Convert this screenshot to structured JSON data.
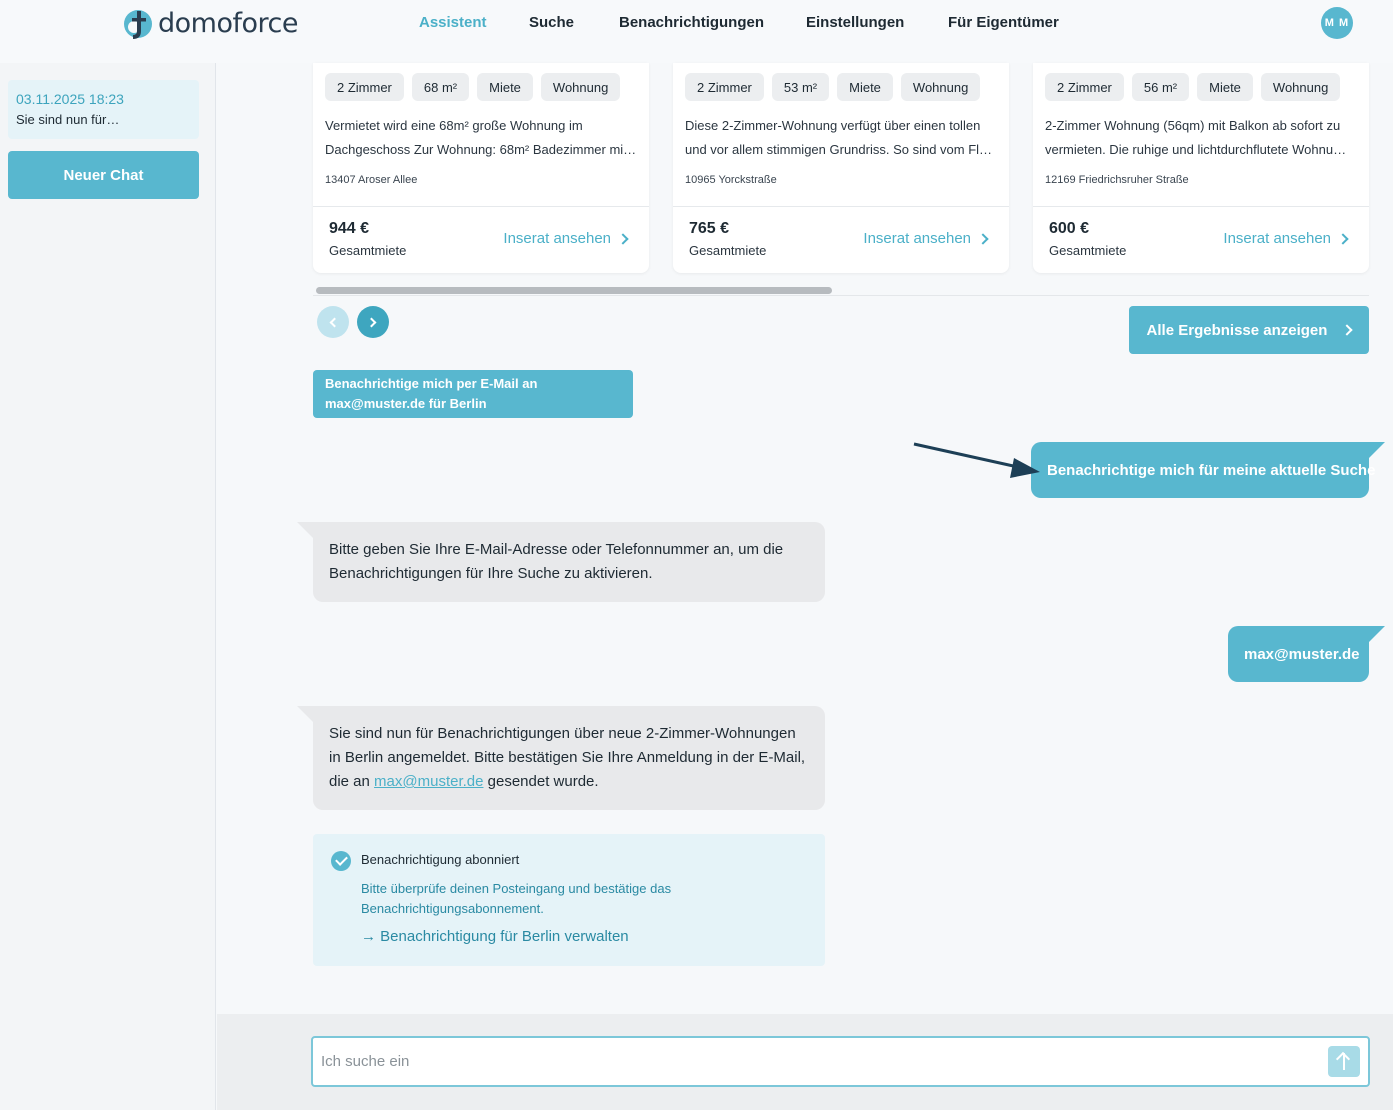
{
  "header": {
    "logo_text": "domoforce",
    "nav": [
      {
        "label": "Assistent",
        "active": true
      },
      {
        "label": "Suche",
        "active": false
      },
      {
        "label": "Benachrichtigungen",
        "active": false
      },
      {
        "label": "Einstellungen",
        "active": false
      },
      {
        "label": "Für Eigentümer",
        "active": false
      }
    ],
    "avatar_initials": "M M"
  },
  "sidebar": {
    "chat_entry": {
      "date": "03.11.2025 18:23",
      "preview": "Sie sind nun für…"
    },
    "new_chat_label": "Neuer Chat"
  },
  "listings": [
    {
      "tags": [
        "2 Zimmer",
        "68 m²",
        "Miete",
        "Wohnung"
      ],
      "desc_line1": "Vermietet wird eine 68m² große Wohnung im",
      "desc_line2": "Dachgeschoss Zur Wohnung: 68m² Badezimmer mi…",
      "address": "13407 Aroser Allee",
      "price": "944 €",
      "price_label": "Gesamtmiete",
      "link_label": "Inserat ansehen"
    },
    {
      "tags": [
        "2 Zimmer",
        "53 m²",
        "Miete",
        "Wohnung"
      ],
      "desc_line1": "Diese 2-Zimmer-Wohnung verfügt über einen tollen",
      "desc_line2": "und vor allem stimmigen Grundriss. So sind vom Fl…",
      "address": "10965 Yorckstraße",
      "price": "765 €",
      "price_label": "Gesamtmiete",
      "link_label": "Inserat ansehen"
    },
    {
      "tags": [
        "2 Zimmer",
        "56 m²",
        "Miete",
        "Wohnung"
      ],
      "desc_line1": "2-Zimmer Wohnung (56qm) mit Balkon ab sofort zu",
      "desc_line2": "vermieten. Die ruhige und lichtdurchflutete Wohnu…",
      "address": "12169 Friedrichsruher Straße",
      "price": "600 €",
      "price_label": "Gesamtmiete",
      "link_label": "Inserat ansehen"
    }
  ],
  "carousel": {
    "all_results_label": "Alle Ergebnisse anzeigen"
  },
  "chat": {
    "suggestion_line1": "Benachrichtige mich per E-Mail an",
    "suggestion_line2": "max@muster.de für Berlin",
    "user_msg_1": "Benachrichtige mich für meine aktuelle Suche",
    "bot_msg_1": "Bitte geben Sie Ihre E-Mail-Adresse oder Telefonnummer an, um die Benachrichtigungen für Ihre Suche zu aktivieren.",
    "user_msg_2": "max@muster.de",
    "bot_msg_2_before": "Sie sind nun für Benachrichtigungen über neue 2-Zimmer-Wohnungen in Berlin angemeldet. Bitte bestätigen Sie Ihre Anmeldung in der E-Mail, die an ",
    "bot_msg_2_link": "max@muster.de",
    "bot_msg_2_after": " gesendet wurde.",
    "subscription": {
      "title": "Benachrichtigung abonniert",
      "text": "Bitte überprüfe deinen Posteingang und bestätige das Benachrichtigungsabonnement.",
      "link": "→ Benachrichtigung für Berlin verwalten"
    }
  },
  "input": {
    "placeholder": "Ich suche ein"
  },
  "colors": {
    "accent": "#58b7cf",
    "accent_dark": "#3ea6bf",
    "nav_active": "#4bb0c8",
    "annotation_arrow": "#1d3f56"
  }
}
